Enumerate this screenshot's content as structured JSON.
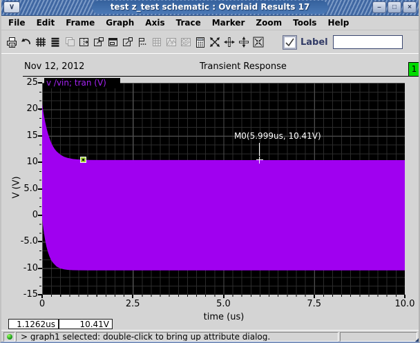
{
  "window": {
    "title": "test z_test schematic : Overlaid Results 17",
    "menu_button_glyph": "∨",
    "minimize_glyph": "–",
    "maximize_glyph": "□",
    "close_glyph": "×"
  },
  "menu_bar": {
    "items": [
      "File",
      "Edit",
      "Frame",
      "Graph",
      "Axis",
      "Trace",
      "Marker",
      "Zoom",
      "Tools",
      "Help"
    ]
  },
  "toolbar": {
    "icons": [
      {
        "name": "print",
        "disabled": false
      },
      {
        "name": "undo",
        "disabled": false
      },
      {
        "name": "grid",
        "disabled": false
      },
      {
        "name": "strip-chart",
        "disabled": false
      },
      {
        "name": "copy-window",
        "disabled": true
      },
      {
        "name": "split-window",
        "disabled": false
      },
      {
        "name": "pop-out-window",
        "disabled": false
      },
      {
        "name": "banner-window",
        "disabled": false
      },
      {
        "name": "new-window",
        "disabled": false
      },
      {
        "name": "label-marker",
        "disabled": false
      },
      {
        "name": "data-table",
        "disabled": true
      },
      {
        "name": "overlay-waveforms",
        "disabled": true
      },
      {
        "name": "strip-waveforms",
        "disabled": true
      },
      {
        "name": "calculator",
        "disabled": false
      },
      {
        "name": "fit-xy",
        "disabled": false
      },
      {
        "name": "fit-x",
        "disabled": false
      },
      {
        "name": "fit-y",
        "disabled": false
      },
      {
        "name": "fit-all",
        "disabled": false
      }
    ],
    "label_checkbox": {
      "label": "Label",
      "checked": true
    },
    "label_input": {
      "value": ""
    }
  },
  "header": {
    "date": "Nov 12, 2012",
    "title": "Transient Response",
    "page_badge": "1"
  },
  "plot": {
    "legend": "v /vin; tran (V)",
    "y_axis_label": "V (V)",
    "x_axis_label": "time (us)",
    "y_ticks": [
      "25",
      "20",
      "15",
      "10",
      "5.0",
      "0",
      "-5.0",
      "-10",
      "-15"
    ],
    "x_ticks": [
      "0",
      "2.5",
      "5.0",
      "7.5",
      "10.0"
    ],
    "trace_color": "#a000f0",
    "grid_color_minor": "#2c2c2c",
    "grid_color_major": "#4e4e4e"
  },
  "readouts": {
    "x_value": "1.1262us",
    "y_value": "10.41V"
  },
  "status_bar": {
    "message": "> graph1 selected: double-click to bring up attribute dialog."
  },
  "chart_data": {
    "type": "area",
    "title": "Transient Response",
    "xlabel": "time (us)",
    "ylabel": "V (V)",
    "xlim": [
      0,
      10
    ],
    "ylim": [
      -15,
      25
    ],
    "x_tick_values": [
      0,
      2.5,
      5.0,
      7.5,
      10.0
    ],
    "y_tick_values": [
      25,
      20,
      15,
      10,
      5.0,
      0,
      -5.0,
      -10,
      -15
    ],
    "grid": true,
    "legend_position": "top-left",
    "series": [
      {
        "name": "v /vin; tran (V)",
        "color": "#a000f0",
        "description": "dense oscillation filled between decaying envelopes, settling to +/-10.41 V",
        "envelope_top": {
          "t_us": [
            0,
            0.04,
            0.08,
            0.12,
            0.16,
            0.2,
            0.25,
            0.3,
            0.35,
            0.4,
            0.5,
            0.6,
            0.7,
            0.85,
            1.0,
            1.2,
            1.5,
            10
          ],
          "v": [
            21.0,
            19.2,
            17.75,
            16.5,
            15.45,
            14.6,
            13.7,
            13.0,
            12.45,
            12.05,
            11.45,
            11.06,
            10.82,
            10.62,
            10.52,
            10.45,
            10.42,
            10.41
          ]
        },
        "envelope_bottom": {
          "t_us": [
            0,
            0.04,
            0.08,
            0.12,
            0.16,
            0.2,
            0.25,
            0.3,
            0.4,
            0.5,
            0.6,
            0.7,
            0.85,
            1.0,
            1.5,
            10
          ],
          "v": [
            -0.7,
            -2.9,
            -4.6,
            -5.95,
            -6.95,
            -7.75,
            -8.5,
            -9.0,
            -9.7,
            -10.03,
            -10.21,
            -10.31,
            -10.37,
            -10.39,
            -10.41,
            -10.41
          ]
        }
      }
    ],
    "markers": [
      {
        "name": "M0",
        "label": "M0(5.999us, 10.41V)",
        "x_us": 5.999,
        "y_V": 10.41,
        "style": "crosshair"
      },
      {
        "name": "box-marker",
        "x_us": 1.1262,
        "y_V": 10.41,
        "style": "box"
      }
    ]
  }
}
